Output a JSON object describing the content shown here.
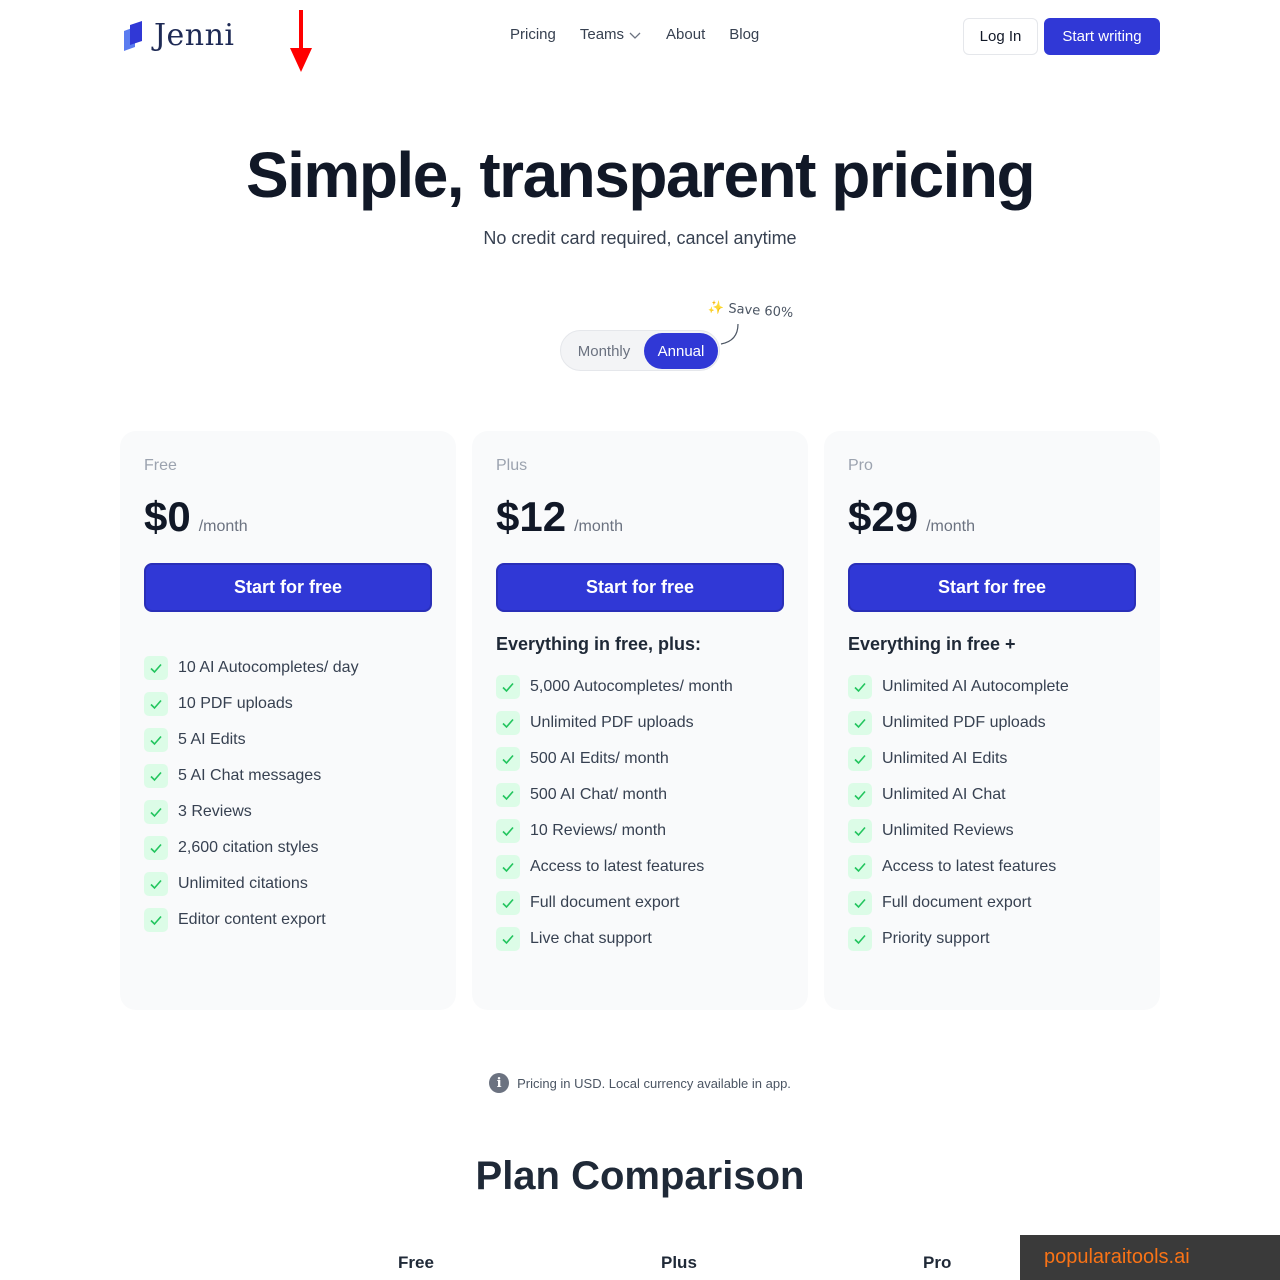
{
  "header": {
    "logo_text": "Jenni",
    "nav": [
      {
        "label": "Pricing"
      },
      {
        "label": "Teams"
      },
      {
        "label": "About"
      },
      {
        "label": "Blog"
      }
    ],
    "login_label": "Log In",
    "start_label": "Start writing"
  },
  "hero": {
    "title": "Simple, transparent pricing",
    "subtitle": "No credit card required, cancel anytime"
  },
  "billing_toggle": {
    "monthly": "Monthly",
    "annual": "Annual",
    "selected": "Annual",
    "save_badge": "✨ Save 60%"
  },
  "plans": [
    {
      "name": "Free",
      "price": "$0",
      "per": "/month",
      "cta": "Start for free",
      "subheading": "",
      "features": [
        "10 AI Autocompletes/ day",
        "10 PDF uploads",
        "5 AI Edits",
        "5 AI Chat messages",
        "3 Reviews",
        "2,600 citation styles",
        "Unlimited citations",
        "Editor content export"
      ]
    },
    {
      "name": "Plus",
      "price": "$12",
      "per": "/month",
      "cta": "Start for free",
      "subheading": "Everything in free, plus:",
      "features": [
        "5,000 Autocompletes/ month",
        "Unlimited PDF uploads",
        "500 AI Edits/ month",
        "500 AI Chat/ month",
        "10 Reviews/ month",
        "Access to latest features",
        "Full document export",
        "Live chat support"
      ]
    },
    {
      "name": "Pro",
      "price": "$29",
      "per": "/month",
      "cta": "Start for free",
      "subheading": "Everything in free +",
      "features": [
        "Unlimited AI Autocomplete",
        "Unlimited PDF uploads",
        "Unlimited AI Edits",
        "Unlimited AI Chat",
        "Unlimited Reviews",
        "Access to latest features",
        "Full document export",
        "Priority support"
      ]
    }
  ],
  "note": "Pricing in USD. Local currency available in app.",
  "comparison": {
    "title": "Plan Comparison",
    "columns": [
      "Free",
      "Plus",
      "Pro"
    ]
  },
  "watermark": "popularaitools.ai",
  "colors": {
    "accent": "#3038d6",
    "check_bg": "#dcfce7",
    "check": "#22c55e",
    "arrow": "#ff0000"
  }
}
